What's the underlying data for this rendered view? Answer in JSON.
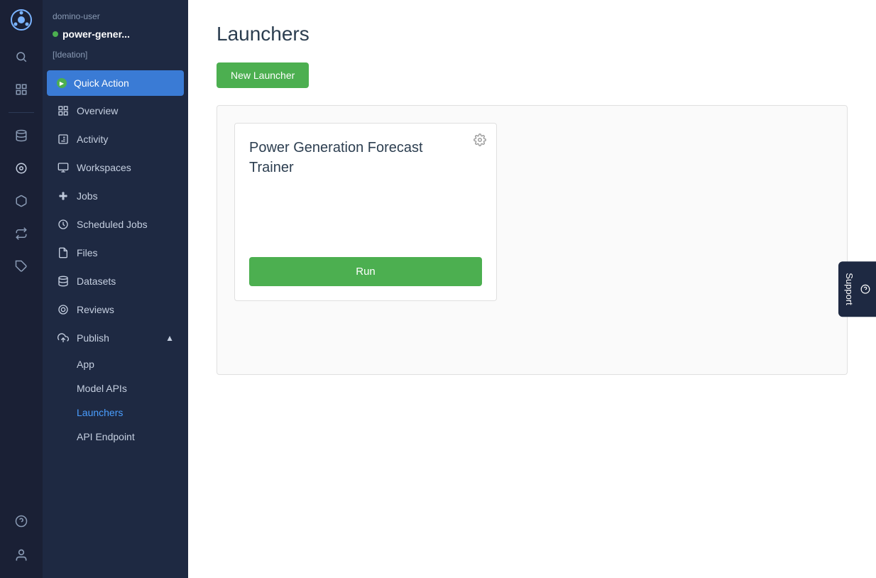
{
  "app": {
    "title": "Domino"
  },
  "user": {
    "username": "domino-user",
    "project_name": "power-gener...",
    "project_status": "active",
    "project_tag": "[Ideation]"
  },
  "icon_sidebar": {
    "items": [
      {
        "name": "home-icon",
        "symbol": "⊞"
      },
      {
        "name": "search-icon",
        "symbol": "🔍"
      },
      {
        "name": "grid-icon",
        "symbol": "⚏"
      },
      {
        "name": "database-icon",
        "symbol": "🗄"
      },
      {
        "name": "project-icon",
        "symbol": "◎"
      },
      {
        "name": "cube-icon",
        "symbol": "◻"
      },
      {
        "name": "transfer-icon",
        "symbol": "⇄"
      },
      {
        "name": "tag-icon",
        "symbol": "🏷"
      }
    ],
    "bottom_items": [
      {
        "name": "help-icon",
        "symbol": "?"
      },
      {
        "name": "user-icon",
        "symbol": "👤"
      }
    ]
  },
  "nav_sidebar": {
    "quick_action_label": "Quick Action",
    "items": [
      {
        "id": "overview",
        "label": "Overview",
        "icon": "overview"
      },
      {
        "id": "activity",
        "label": "Activity",
        "icon": "activity"
      },
      {
        "id": "workspaces",
        "label": "Workspaces",
        "icon": "workspaces"
      },
      {
        "id": "jobs",
        "label": "Jobs",
        "icon": "jobs"
      },
      {
        "id": "scheduled-jobs",
        "label": "Scheduled Jobs",
        "icon": "scheduled-jobs"
      },
      {
        "id": "files",
        "label": "Files",
        "icon": "files"
      },
      {
        "id": "datasets",
        "label": "Datasets",
        "icon": "datasets"
      },
      {
        "id": "reviews",
        "label": "Reviews",
        "icon": "reviews"
      }
    ],
    "publish": {
      "label": "Publish",
      "expanded": true,
      "sub_items": [
        {
          "id": "app",
          "label": "App"
        },
        {
          "id": "model-apis",
          "label": "Model APIs"
        },
        {
          "id": "launchers",
          "label": "Launchers",
          "active": true
        },
        {
          "id": "api-endpoint",
          "label": "API Endpoint"
        }
      ]
    }
  },
  "main": {
    "page_title": "Launchers",
    "new_launcher_button": "New Launcher",
    "launcher_card": {
      "title": "Power Generation Forecast Trainer",
      "run_button": "Run"
    }
  },
  "support": {
    "label": "Support"
  },
  "colors": {
    "active_green": "#4caf50",
    "nav_active_blue": "#3a7bd5",
    "sidebar_bg": "#1e2942",
    "icon_sidebar_bg": "#1a2035"
  }
}
